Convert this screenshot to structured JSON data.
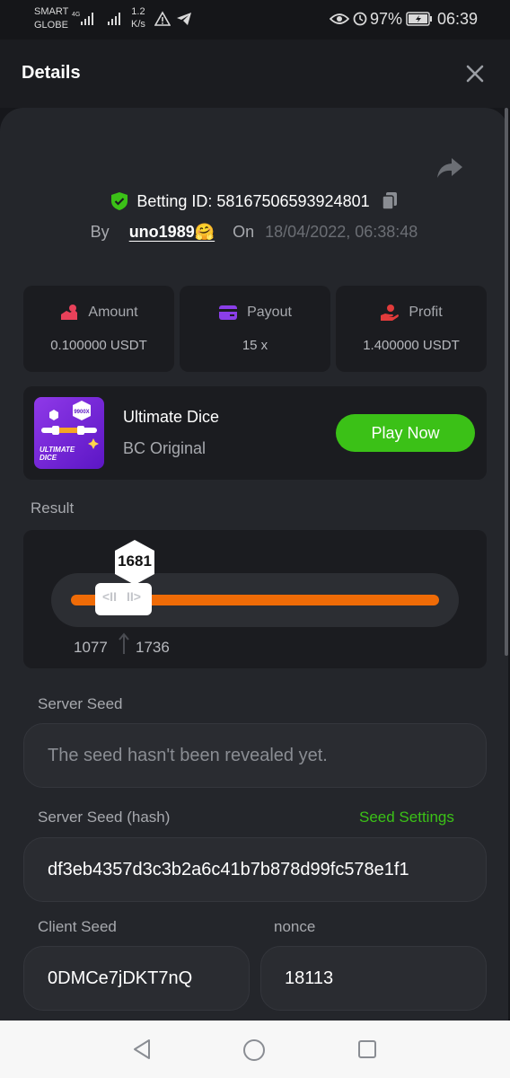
{
  "status_bar": {
    "carrier_line1": "SMART",
    "carrier_line2": "GLOBE",
    "speed_value": "1.2",
    "speed_unit": "K/s",
    "battery": "97%",
    "time": "06:39"
  },
  "header": {
    "title": "Details",
    "close_icon": "close-icon"
  },
  "bet": {
    "betting_id_label": "Betting ID: 58167506593924801",
    "by_label": "By",
    "username": "uno1989🤗",
    "on_label": "On",
    "datetime": "18/04/2022, 06:38:48"
  },
  "stats": [
    {
      "label": "Amount",
      "value": "0.100000 USDT",
      "icon": "amount-icon",
      "color": "#e8415a"
    },
    {
      "label": "Payout",
      "value": "15 x",
      "icon": "payout-card-icon",
      "color": "#8a3ee8"
    },
    {
      "label": "Profit",
      "value": "1.400000 USDT",
      "icon": "profit-hand-icon",
      "color": "#e23b3b"
    }
  ],
  "game": {
    "name": "Ultimate Dice",
    "subtitle": "BC Original",
    "play_label": "Play Now",
    "thumb_badge": "9900X",
    "thumb_title_line1": "ULTIMATE",
    "thumb_title_line2": "DICE"
  },
  "result": {
    "label": "Result",
    "value": "1681",
    "range_min": "1077",
    "range_max": "1736",
    "bar_color": "#ef6b07"
  },
  "seeds": {
    "server_seed_label": "Server Seed",
    "server_seed_placeholder": "The seed hasn't been revealed yet.",
    "server_seed_hash_label": "Server Seed (hash)",
    "seed_settings_label": "Seed Settings",
    "server_seed_hash": "df3eb4357d3c3b2a6c41b7b878d99fc578e1f1",
    "client_seed_label": "Client Seed",
    "client_seed": "0DMCe7jDKT7nQ",
    "nonce_label": "nonce",
    "nonce": "18113"
  },
  "colors": {
    "accent_green": "#3bc117",
    "background": "#16171b",
    "panel": "#24262b",
    "card": "#1b1c20"
  }
}
